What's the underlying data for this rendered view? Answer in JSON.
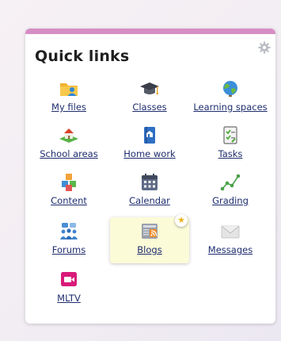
{
  "quick_links": {
    "title": "Quick links",
    "items": [
      {
        "label": "My files",
        "icon": "folder-user-icon"
      },
      {
        "label": "Classes",
        "icon": "graduation-cap-icon"
      },
      {
        "label": "Learning spaces",
        "icon": "globe-icon"
      },
      {
        "label": "School areas",
        "icon": "school-building-icon"
      },
      {
        "label": "Home work",
        "icon": "notebook-icon"
      },
      {
        "label": "Tasks",
        "icon": "checklist-icon"
      },
      {
        "label": "Content",
        "icon": "cubes-icon"
      },
      {
        "label": "Calendar",
        "icon": "calendar-icon"
      },
      {
        "label": "Grading",
        "icon": "line-chart-icon"
      },
      {
        "label": "Forums",
        "icon": "forum-people-icon"
      },
      {
        "label": "Blogs",
        "icon": "blog-feed-icon",
        "highlighted": true
      },
      {
        "label": "Messages",
        "icon": "envelope-icon"
      },
      {
        "label": "MLTV",
        "icon": "video-camera-icon"
      }
    ]
  },
  "colors": {
    "accent_bar": "#d78ec4",
    "link": "#1e2d6e",
    "highlight_bg": "#fbfbd8",
    "star": "#e8b21b"
  }
}
